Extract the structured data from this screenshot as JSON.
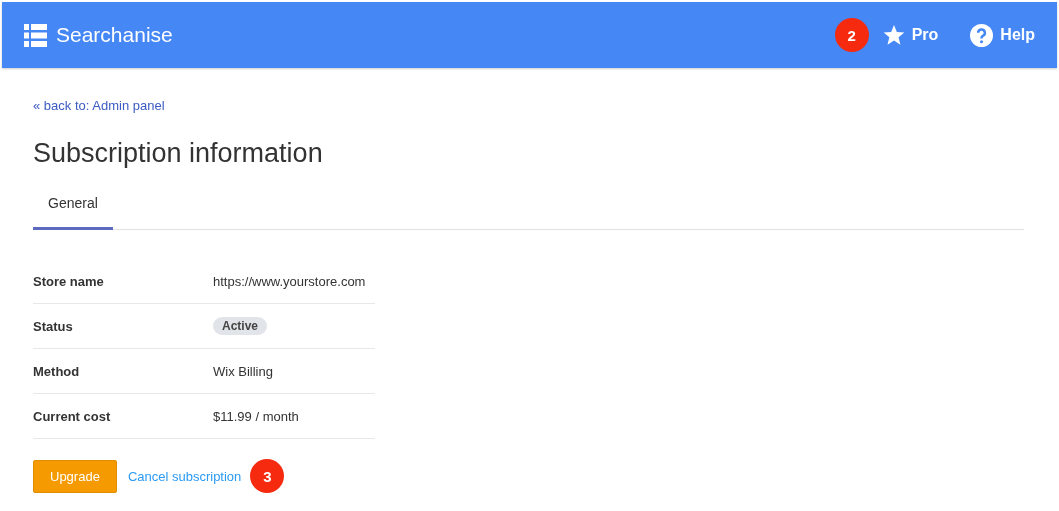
{
  "header": {
    "brand": "Searchanise",
    "step_marker": "2",
    "links": [
      {
        "kind": "star",
        "label": "Pro"
      },
      {
        "kind": "help",
        "label": "Help"
      }
    ]
  },
  "back_link": "« back to: Admin panel",
  "title": "Subscription information",
  "tabs": [
    {
      "label": "General",
      "selected": true
    }
  ],
  "details": [
    {
      "kind": "text",
      "label": "Store name",
      "value": "https://www.yourstore.com"
    },
    {
      "kind": "badge",
      "label": "Status",
      "value": "Active"
    },
    {
      "kind": "text",
      "label": "Method",
      "value": "Wix Billing"
    },
    {
      "kind": "text",
      "label": "Current cost",
      "value": "$11.99 / month"
    }
  ],
  "actions": {
    "upgrade": "Upgrade",
    "cancel": "Cancel subscription",
    "step_marker": "3"
  }
}
